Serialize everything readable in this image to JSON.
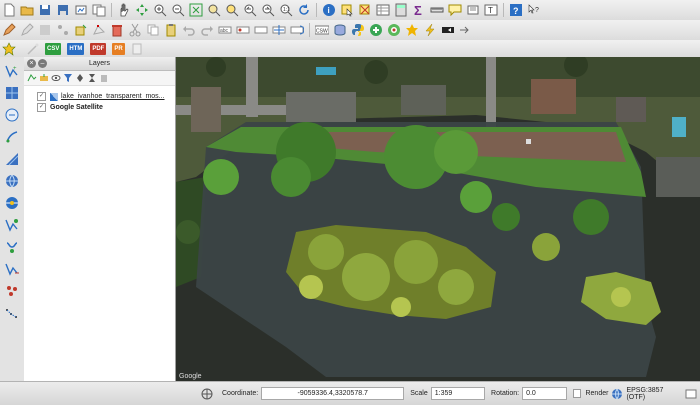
{
  "layers_panel": {
    "title": "Layers",
    "items": [
      {
        "name": "lake_ivanhoe_transparent_mos...",
        "checked": true,
        "bold": false
      },
      {
        "name": "Google Satellite",
        "checked": true,
        "bold": true
      }
    ]
  },
  "toolbar3_badges": {
    "csv": "CSV",
    "htm": "HTM",
    "pdf": "PDF",
    "pr": "PR"
  },
  "map": {
    "attribution": "Google"
  },
  "statusbar": {
    "coordinate_label": "Coordinate:",
    "coordinate_value": "-9059336.4,3320578.7",
    "scale_label": "Scale",
    "scale_value": "1:359",
    "rotation_label": "Rotation:",
    "rotation_value": "0.0",
    "render_label": "Render",
    "render_checked": false,
    "crs_label": "EPSG:3857 (OTF)"
  },
  "colors": {
    "accent_green": "#2e9e3f",
    "accent_blue": "#2b6fc4",
    "pdf_red": "#c0392b",
    "pr_orange": "#e67e22"
  }
}
